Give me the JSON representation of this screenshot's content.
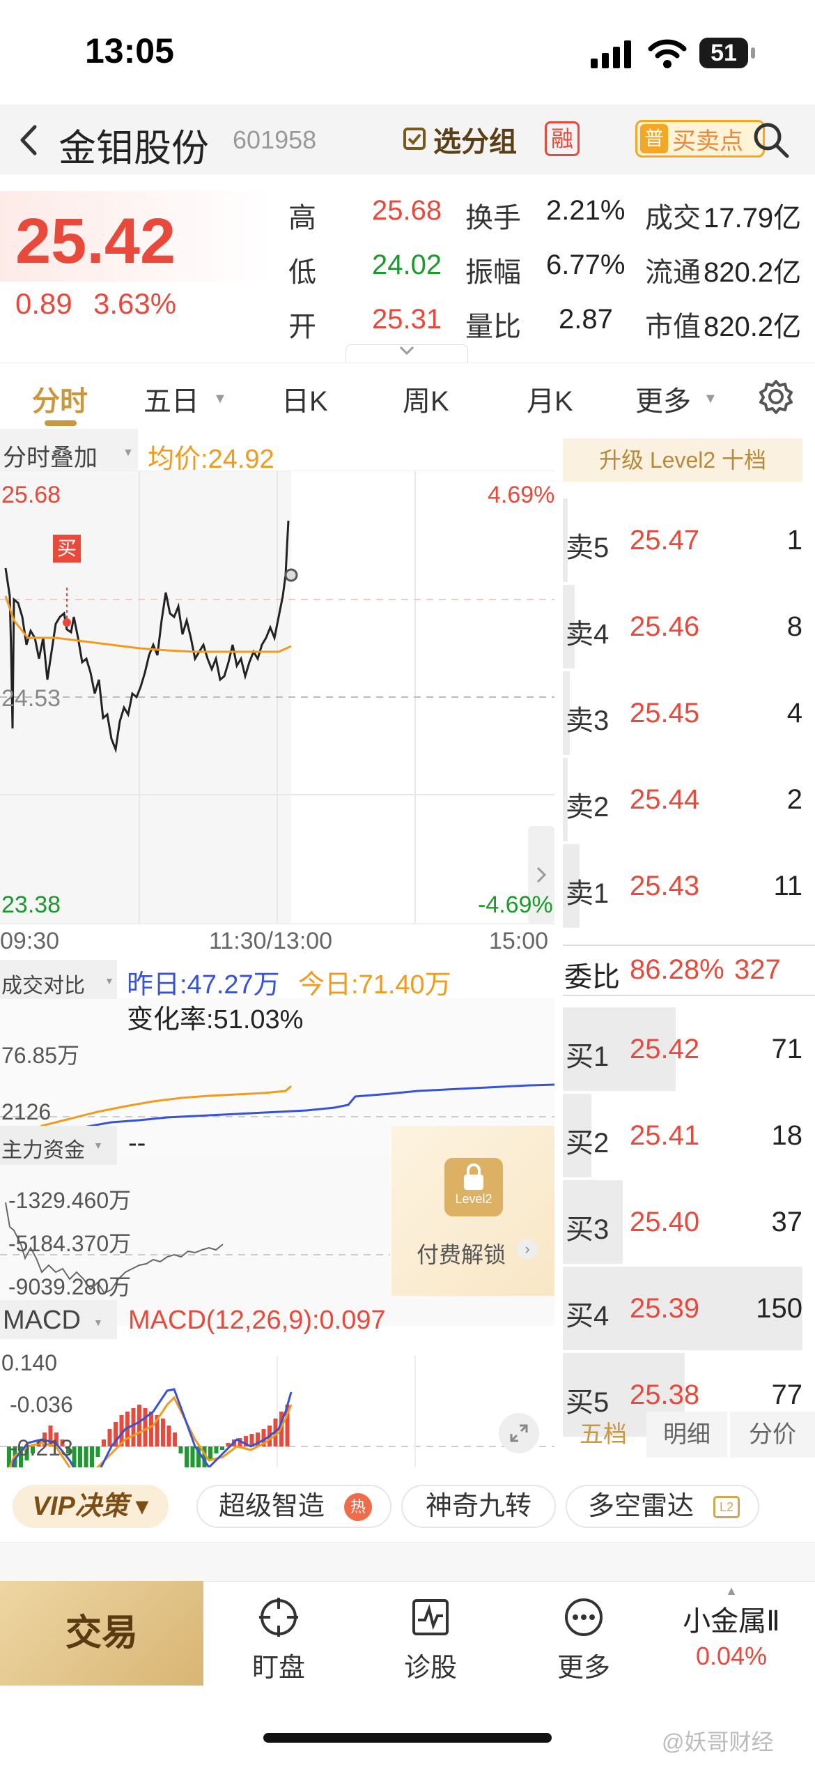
{
  "status_bar": {
    "time": "13:05",
    "battery": "51"
  },
  "header": {
    "stock_name": "金钼股份",
    "stock_code": "601958",
    "group_button": "选分组",
    "margin_badge": "融",
    "pu_badge": "普",
    "buy_sell_point": "买卖点"
  },
  "quote": {
    "price": "25.42",
    "change": "0.89",
    "change_pct": "3.63%",
    "rows": [
      {
        "l1": "高",
        "v1": "25.68",
        "l2": "换手",
        "v2": "2.21%",
        "l3": "成交",
        "v3": "17.79亿"
      },
      {
        "l1": "低",
        "v1": "24.02",
        "l2": "振幅",
        "v2": "6.77%",
        "l3": "流通",
        "v3": "820.2亿"
      },
      {
        "l1": "开",
        "v1": "25.31",
        "l2": "量比",
        "v2": "2.87",
        "l3": "市值",
        "v3": "820.2亿"
      }
    ]
  },
  "tabs": [
    "分时",
    "五日",
    "日K",
    "周K",
    "月K",
    "更多"
  ],
  "active_tab": "分时",
  "intraday": {
    "overlay_label": "分时叠加",
    "avg_price_label": "均价:24.92",
    "y_high": "25.68",
    "y_mid": "24.53",
    "y_low": "23.38",
    "pct_high": "4.69%",
    "pct_low": "-4.69%",
    "x_labels": [
      "09:30",
      "11:30/13:00",
      "15:00"
    ],
    "buy_marker": "买"
  },
  "volume_compare": {
    "label": "成交对比",
    "yesterday": "昨日:47.27万",
    "today": "今日:71.40万",
    "change_rate": "变化率:51.03%",
    "y_top": "76.85万",
    "y_bottom": "2126"
  },
  "main_funds": {
    "label": "主力资金",
    "value": "--",
    "y1": "-1329.460万",
    "y2": "-5184.370万",
    "y3": "-9039.280万",
    "lock_badge": "Level2",
    "unlock_text": "付费解锁"
  },
  "macd": {
    "label": "MACD",
    "value_text": "MACD(12,26,9):0.097",
    "y_top": "0.140",
    "y_mid": "-0.036",
    "y_bottom": "-0.213"
  },
  "order_book": {
    "upgrade_text": "升级 Level2 十档",
    "sell": [
      {
        "label": "卖5",
        "price": "25.47",
        "vol": "1",
        "w": 0.02
      },
      {
        "label": "卖4",
        "price": "25.46",
        "vol": "8",
        "w": 0.05
      },
      {
        "label": "卖3",
        "price": "25.45",
        "vol": "4",
        "w": 0.03
      },
      {
        "label": "卖2",
        "price": "25.44",
        "vol": "2",
        "w": 0.02
      },
      {
        "label": "卖1",
        "price": "25.43",
        "vol": "11",
        "w": 0.07
      }
    ],
    "ratio_label": "委比",
    "ratio_value": "86.28%",
    "ratio_count": "327",
    "buy": [
      {
        "label": "买1",
        "price": "25.42",
        "vol": "71",
        "w": 0.47
      },
      {
        "label": "买2",
        "price": "25.41",
        "vol": "18",
        "w": 0.12
      },
      {
        "label": "买3",
        "price": "25.40",
        "vol": "37",
        "w": 0.25
      },
      {
        "label": "买4",
        "price": "25.39",
        "vol": "150",
        "w": 1.0
      },
      {
        "label": "买5",
        "price": "25.38",
        "vol": "77",
        "w": 0.51
      }
    ],
    "bottom_tabs": [
      "五档",
      "明细",
      "分价"
    ]
  },
  "feature_bar": {
    "vip_label": "VIP决策",
    "items": [
      "超级智造",
      "神奇九转",
      "多空雷达"
    ],
    "hot_badge": "热"
  },
  "bottom_nav": {
    "trade": "交易",
    "items": [
      "盯盘",
      "诊股",
      "更多"
    ],
    "sector_name": "小金属Ⅱ",
    "sector_pct": "0.04%"
  },
  "watermark": "@妖哥财经",
  "colors": {
    "up": "#e8493a",
    "down": "#1c9a2e",
    "avg": "#f29a1c",
    "accent_gold": "#c8a35a"
  }
}
